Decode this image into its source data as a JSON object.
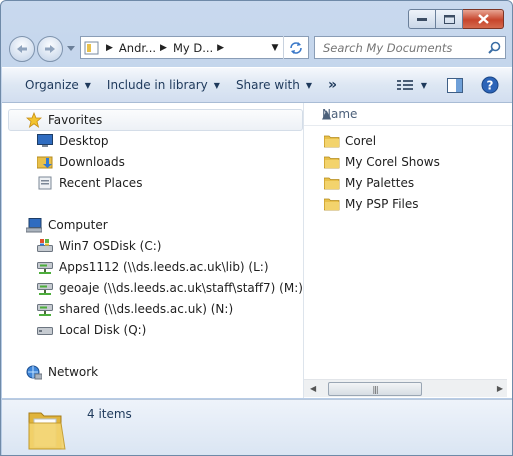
{
  "address": {
    "crumbs": [
      "Andr...",
      "My D..."
    ]
  },
  "search": {
    "placeholder": "Search My Documents"
  },
  "toolbar": {
    "organize": "Organize",
    "include": "Include in library",
    "share": "Share with",
    "more": "»"
  },
  "nav": {
    "favorites": {
      "label": "Favorites",
      "items": [
        {
          "label": "Desktop",
          "icon": "desktop-icon"
        },
        {
          "label": "Downloads",
          "icon": "downloads-folder-icon"
        },
        {
          "label": "Recent Places",
          "icon": "recent-places-icon"
        }
      ]
    },
    "computer": {
      "label": "Computer",
      "items": [
        {
          "label": "Win7 OSDisk (C:)",
          "icon": "os-disk-icon"
        },
        {
          "label": "Apps1112 (\\\\ds.leeds.ac.uk\\lib) (L:)",
          "icon": "network-drive-icon"
        },
        {
          "label": "geoaje (\\\\ds.leeds.ac.uk\\staff\\staff7) (M:)",
          "icon": "network-drive-icon"
        },
        {
          "label": "shared (\\\\ds.leeds.ac.uk) (N:)",
          "icon": "network-drive-icon"
        },
        {
          "label": "Local Disk (Q:)",
          "icon": "local-disk-icon"
        }
      ]
    },
    "network": {
      "label": "Network"
    }
  },
  "content": {
    "column_name": "Name",
    "files": [
      {
        "label": "Corel"
      },
      {
        "label": "My Corel Shows"
      },
      {
        "label": "My Palettes"
      },
      {
        "label": "My PSP Files"
      }
    ]
  },
  "status": {
    "count": "4 items"
  },
  "colors": {
    "folder": "#e8c04a",
    "toolbar_text": "#1e395b",
    "close": "#c7452c"
  }
}
